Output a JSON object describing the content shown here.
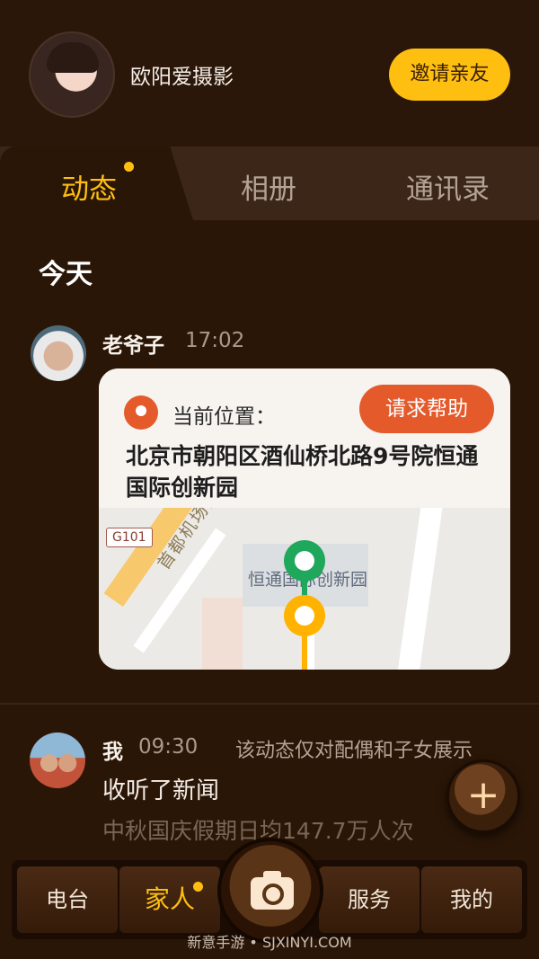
{
  "header": {
    "username": "欧阳爱摄影",
    "invite_label": "邀请亲友"
  },
  "tabs": [
    {
      "label": "动态",
      "active": true,
      "has_dot": true
    },
    {
      "label": "相册",
      "active": false
    },
    {
      "label": "通讯录",
      "active": false
    }
  ],
  "feed": {
    "section_title": "今天",
    "posts": [
      {
        "name": "老爷子",
        "time": "17:02",
        "location_label": "当前位置：",
        "help_button": "请求帮助",
        "address": "北京市朝阳区酒仙桥北路9号院恒通国际创新园",
        "map": {
          "road_tag": "G101",
          "road_label": "首都机场高速",
          "poi_label": "恒通国际创新园"
        }
      },
      {
        "name": "我",
        "time": "09:30",
        "visibility_note": "该动态仅对配偶和子女展示",
        "text": "收听了新闻",
        "subtext": "中秋国庆假期日均147.7万人次"
      }
    ]
  },
  "fab": {
    "icon": "plus-icon",
    "label": "+"
  },
  "bottom_nav": {
    "items": [
      {
        "label": "电台",
        "active": false
      },
      {
        "label": "家人",
        "active": true
      },
      {
        "label": "服务",
        "active": false
      },
      {
        "label": "我的",
        "active": false
      }
    ],
    "camera_icon": "camera-icon"
  },
  "watermark": "新意手游 • SJXINYI.COM",
  "colors": {
    "accent": "#ffbf10",
    "danger": "#e45a2b",
    "background": "#2a1607"
  }
}
